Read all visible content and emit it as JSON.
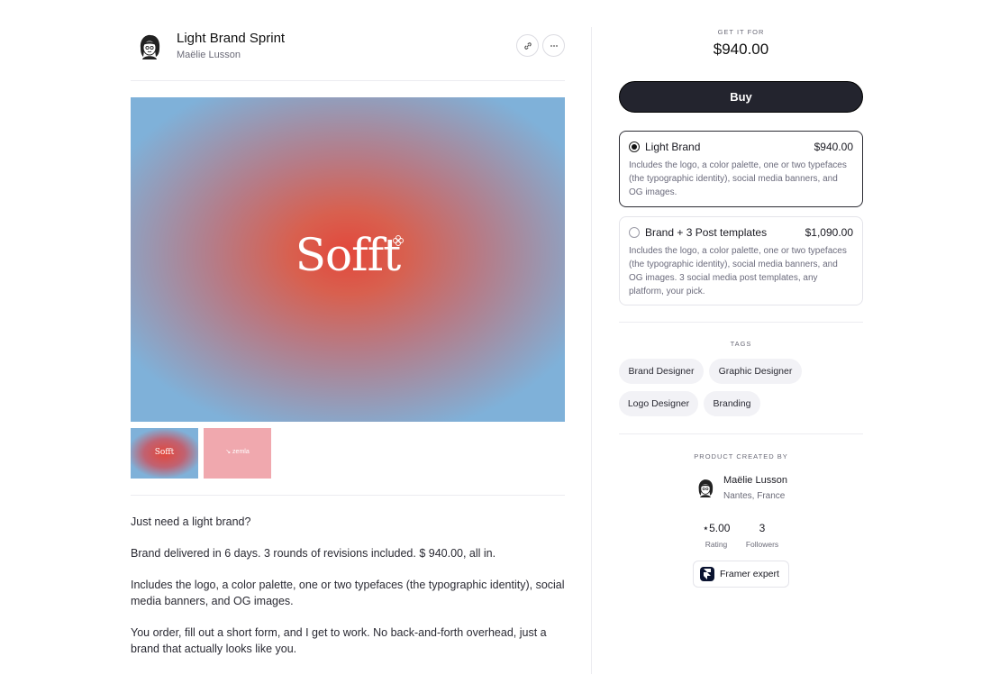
{
  "product": {
    "title": "Light Brand Sprint",
    "author": "Maëlie Lusson",
    "link_icon": "link-icon",
    "more_icon": "more-icon"
  },
  "hero": {
    "logo_text": "Sofft",
    "thumb1_text": "Sofft",
    "thumb2_text": "↘ zemla"
  },
  "description": [
    "Just need a light brand?",
    "Brand delivered in 6 days. 3 rounds of revisions included. $ 940.00, all in.",
    "Includes the logo, a color palette, one or two typefaces (the typographic identity), social media banners, and OG images.",
    "You order, fill out a short form, and I get to work. No back-and-forth overhead, just a brand that actually looks like you."
  ],
  "purchase": {
    "get_it_for": "GET IT FOR",
    "price": "$940.00",
    "buy_label": "Buy"
  },
  "options": [
    {
      "name": "Light Brand",
      "price": "$940.00",
      "selected": true,
      "description": "Includes the logo, a color palette, one or two typefaces (the typographic identity), social media banners, and OG images."
    },
    {
      "name": "Brand + 3 Post templates",
      "price": "$1,090.00",
      "selected": false,
      "description": "Includes the logo, a color palette, one or two typefaces (the typographic identity), social media banners, and OG images. 3 social media post templates, any platform, your pick."
    }
  ],
  "tags": {
    "heading": "TAGS",
    "items": [
      "Brand Designer",
      "Graphic Designer",
      "Logo Designer",
      "Branding"
    ]
  },
  "creator": {
    "heading": "PRODUCT CREATED BY",
    "name": "Maëlie Lusson",
    "location": "Nantes, France",
    "rating_value": "⋆5.00",
    "rating_label": "Rating",
    "followers_value": "3",
    "followers_label": "Followers",
    "badge_label": "Framer expert"
  }
}
